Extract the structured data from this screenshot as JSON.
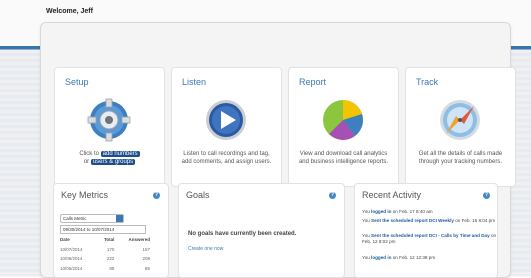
{
  "header": {
    "welcome": "Welcome, Jeff"
  },
  "cards": [
    {
      "title": "Setup",
      "desc_prefix": "Click to",
      "link1": "add numbers",
      "desc_mid": "or",
      "link2": "users & groups",
      "icon": "gear-icon"
    },
    {
      "title": "Listen",
      "desc": "Listen to call recordings and tag, add comments, and assign users.",
      "icon": "play-icon"
    },
    {
      "title": "Report",
      "desc": "View and download call analytics and business intelligence reports.",
      "icon": "pie-chart-icon"
    },
    {
      "title": "Track",
      "desc": "Get all the details of calls made through your tracking numbers.",
      "icon": "compass-icon"
    }
  ],
  "key_metrics": {
    "title": "Key Metrics",
    "select_value": "Calls Metric",
    "date_range": "09/30/2014 to 10/07/2014",
    "headers": [
      "Date",
      "Total",
      "Answered"
    ],
    "rows": [
      [
        "10/07/2014",
        "170",
        "157"
      ],
      [
        "10/06/2014",
        "222",
        "208"
      ],
      [
        "10/05/2014",
        "85",
        "85"
      ]
    ]
  },
  "goals": {
    "title": "Goals",
    "message": "No goals have currently been created.",
    "create_link": "Create one now"
  },
  "recent_activity": {
    "title": "Recent Activity",
    "items": [
      {
        "pre": "You",
        "verb": "logged in",
        "link": "",
        "post": "on Feb. 17 8:40 am"
      },
      {
        "pre": "You",
        "verb": "",
        "link": "Sent the scheduled report DCI Weekly",
        "post": "on Feb. 15 8:04 pm"
      },
      {
        "pre": "You",
        "verb": "",
        "link": "Sent the scheduled report DCI - Calls by Time and Day",
        "post": "on Feb. 12 8:02 pm"
      },
      {
        "pre": "You",
        "verb": "logged in",
        "link": "",
        "post": "on Feb. 12 12:38 pm"
      }
    ]
  }
}
